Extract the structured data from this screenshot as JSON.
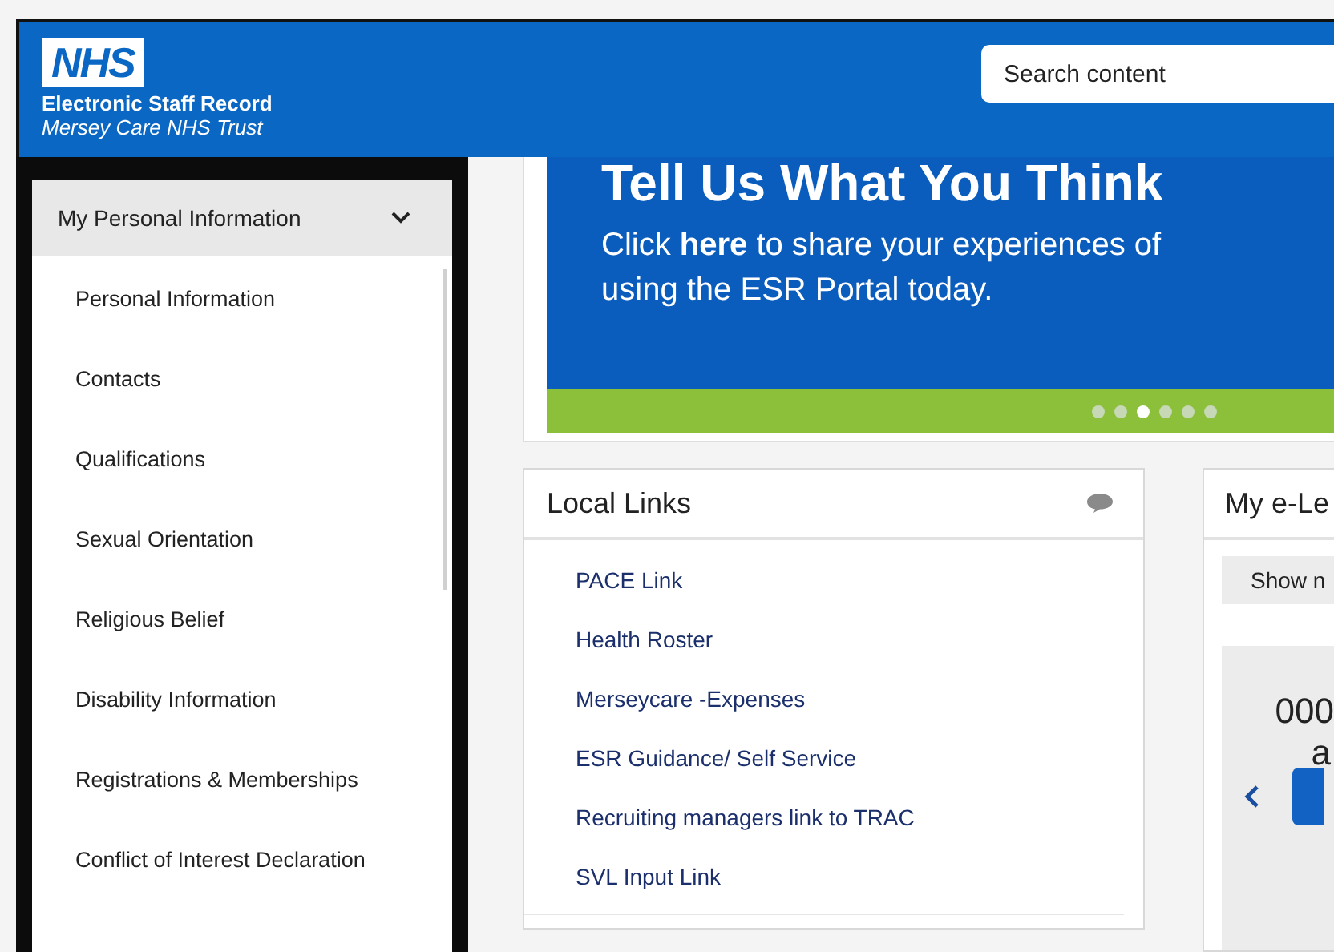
{
  "header": {
    "logo": "NHS",
    "app_name": "Electronic Staff Record",
    "trust": "Mersey Care NHS Trust",
    "search": {
      "placeholder": "Search content"
    }
  },
  "sidebar": {
    "title": "My Personal Information",
    "expanded": true,
    "items": [
      {
        "label": "Personal Information"
      },
      {
        "label": "Contacts"
      },
      {
        "label": "Qualifications"
      },
      {
        "label": "Sexual Orientation"
      },
      {
        "label": "Religious Belief"
      },
      {
        "label": "Disability Information"
      },
      {
        "label": "Registrations & Memberships"
      },
      {
        "label": "Conflict of Interest Declaration"
      }
    ]
  },
  "banner": {
    "title": "Tell Us What You Think",
    "text": "Click **here** to share your experiences of using the ESR Portal today.",
    "dots": [
      {
        "selected": false
      },
      {
        "selected": false
      },
      {
        "selected": true
      },
      {
        "selected": false
      },
      {
        "selected": false
      },
      {
        "selected": false
      }
    ]
  },
  "local_links": {
    "title": "Local Links",
    "links": [
      "PACE Link",
      "Health Roster",
      "Merseycare -Expenses",
      "ESR Guidance/ Self Service",
      "Recruiting managers link to TRAC",
      "SVL Input Link"
    ]
  },
  "elearning": {
    "title": "My e-Le",
    "button": "Show n",
    "count": "000",
    "line_2": "a"
  }
}
